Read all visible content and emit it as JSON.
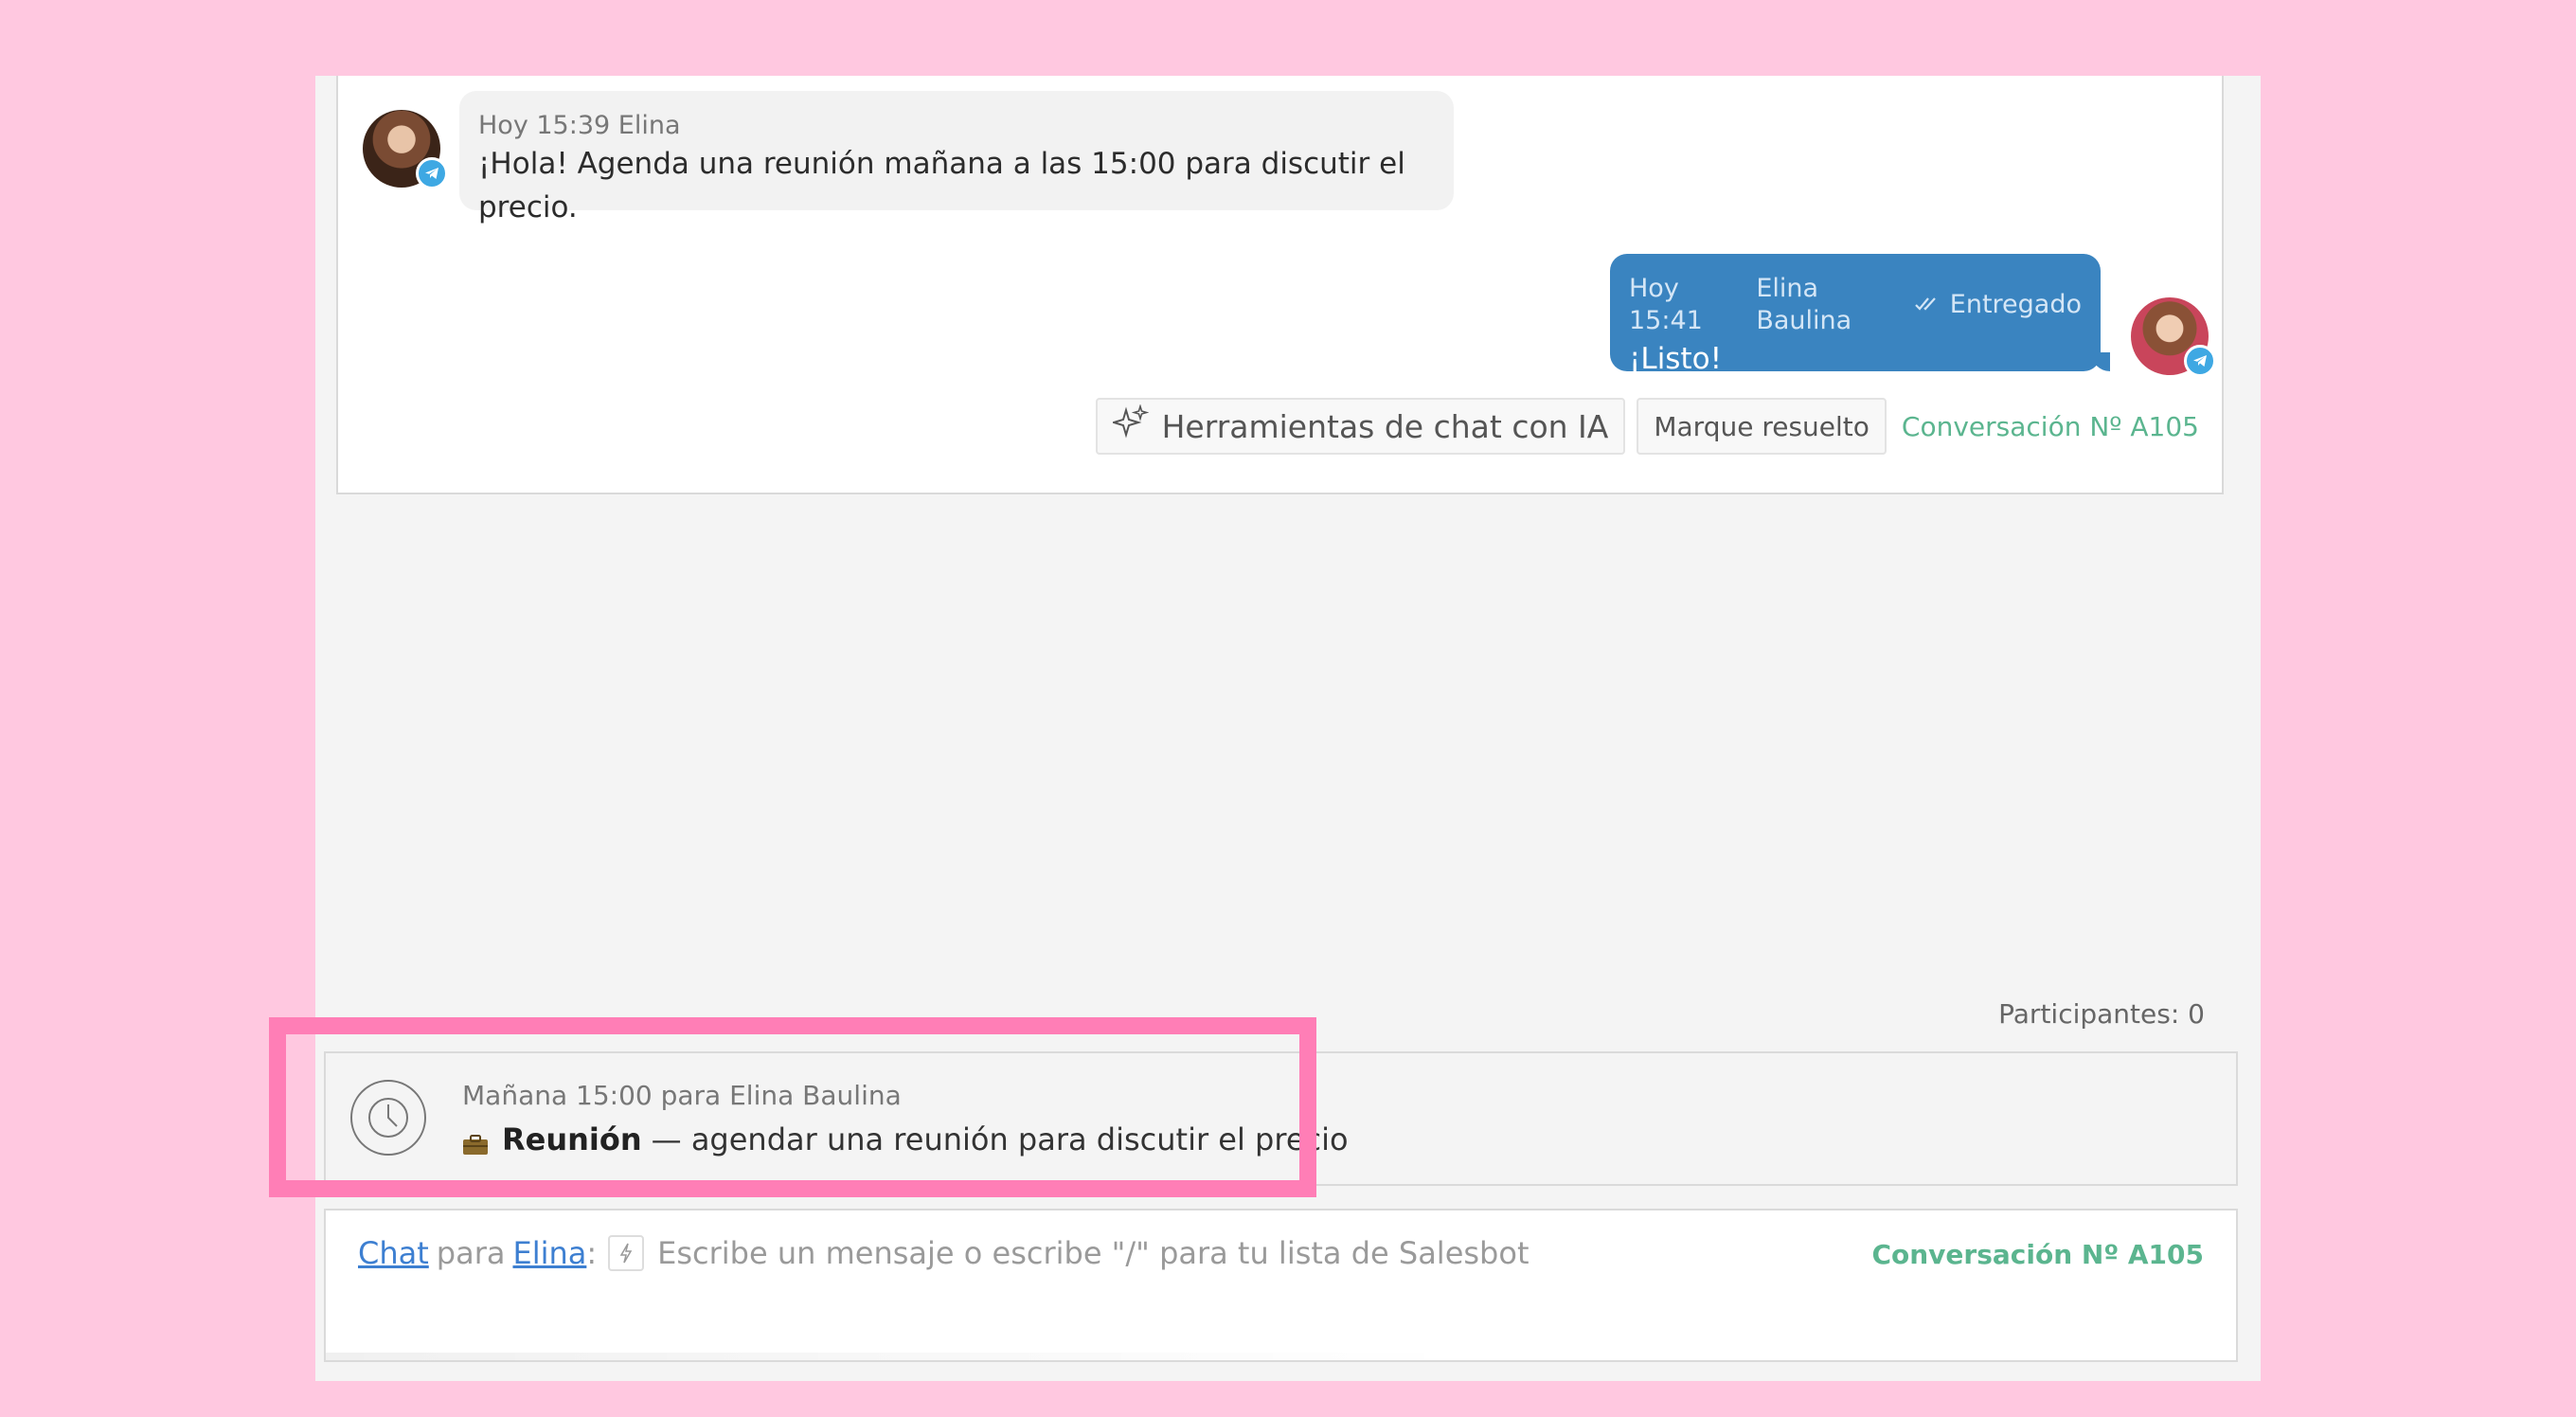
{
  "colors": {
    "page_background": "#ffc8e0",
    "highlight_border": "#ff7eb6",
    "outgoing_bubble": "#3a84c0",
    "link": "#3d7fd1",
    "conversation_id": "#5bb58f"
  },
  "messages": [
    {
      "direction": "incoming",
      "time": "Hoy 15:39",
      "author": "Elina",
      "text": "¡Hola! Agenda una reunión mañana a las 15:00 para discutir el precio.",
      "channel_icon": "telegram-icon"
    },
    {
      "direction": "outgoing",
      "time": "Hoy 15:41",
      "author": "Elina Baulina",
      "status": "Entregado",
      "text": "¡Listo!",
      "channel_icon": "telegram-icon"
    }
  ],
  "actions": {
    "ai_tools_label": "Herramientas de chat con IA",
    "resolve_label": "Marque resuelto",
    "conversation_id": "Conversación Nº A105"
  },
  "participants_label": "Participantes: 0",
  "task": {
    "when": "Mañana 15:00 para Elina Baulina",
    "type": "Reunión",
    "description": "— agendar una reunión para discutir el precio"
  },
  "composer": {
    "chat_link": "Chat",
    "para": "para",
    "recipient_link": "Elina",
    "colon": ":",
    "placeholder": "Escribe un mensaje o escribe \"/\" para tu lista de Salesbot",
    "conversation_id": "Conversación Nº A105"
  }
}
